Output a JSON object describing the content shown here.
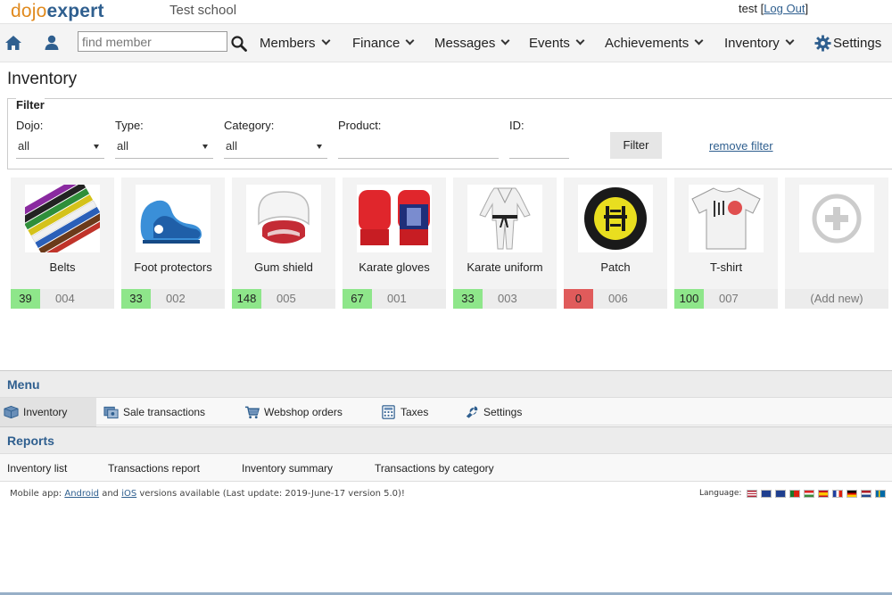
{
  "header": {
    "logo_left": "dojo",
    "logo_right": "expert",
    "school_name": "Test school",
    "username": "test",
    "logout_label": "Log Out"
  },
  "nav": {
    "search_placeholder": "find member",
    "items": [
      {
        "label": "Members"
      },
      {
        "label": "Finance"
      },
      {
        "label": "Messages"
      },
      {
        "label": "Events"
      },
      {
        "label": "Achievements"
      },
      {
        "label": "Inventory"
      }
    ],
    "settings_label": "Settings"
  },
  "page": {
    "title": "Inventory"
  },
  "filter": {
    "legend": "Filter",
    "dojo_label": "Dojo:",
    "dojo_value": "all",
    "type_label": "Type:",
    "type_value": "all",
    "category_label": "Category:",
    "category_value": "all",
    "product_label": "Product:",
    "product_value": "",
    "id_label": "ID:",
    "id_value": "",
    "filter_button": "Filter",
    "remove_filter": "remove filter"
  },
  "products": [
    {
      "name": "Belts",
      "stock": "39",
      "code": "004",
      "icon": "belts-icon",
      "status": "ok"
    },
    {
      "name": "Foot protectors",
      "stock": "33",
      "code": "002",
      "icon": "foot-protector-icon",
      "status": "ok"
    },
    {
      "name": "Gum shield",
      "stock": "148",
      "code": "005",
      "icon": "gum-shield-icon",
      "status": "ok"
    },
    {
      "name": "Karate gloves",
      "stock": "67",
      "code": "001",
      "icon": "gloves-icon",
      "status": "ok"
    },
    {
      "name": "Karate uniform",
      "stock": "33",
      "code": "003",
      "icon": "uniform-icon",
      "status": "ok"
    },
    {
      "name": "Patch",
      "stock": "0",
      "code": "006",
      "icon": "patch-icon",
      "status": "out"
    },
    {
      "name": "T-shirt",
      "stock": "100",
      "code": "007",
      "icon": "tshirt-icon",
      "status": "ok"
    }
  ],
  "add_new_label": "(Add new)",
  "menu": {
    "heading": "Menu",
    "items": [
      {
        "label": "Inventory",
        "icon": "box-icon"
      },
      {
        "label": "Sale transactions",
        "icon": "cash-icon"
      },
      {
        "label": "Webshop orders",
        "icon": "cart-icon"
      },
      {
        "label": "Taxes",
        "icon": "calculator-icon"
      },
      {
        "label": "Settings",
        "icon": "wrench-icon"
      }
    ]
  },
  "reports": {
    "heading": "Reports",
    "items": [
      {
        "label": "Inventory list"
      },
      {
        "label": "Transactions report"
      },
      {
        "label": "Inventory summary"
      },
      {
        "label": "Transactions by category"
      }
    ]
  },
  "footer": {
    "prefix": "Mobile app: ",
    "android": "Android",
    "and": " and ",
    "ios": "iOS",
    "suffix": " versions available (Last update: 2019-June-17 version 5.0)!",
    "language_label": "Language:"
  },
  "colors": {
    "accent": "#2f5f8f",
    "logo_orange": "#e08a1e",
    "stock_ok": "#8ee68a",
    "stock_out": "#e05b5b"
  }
}
